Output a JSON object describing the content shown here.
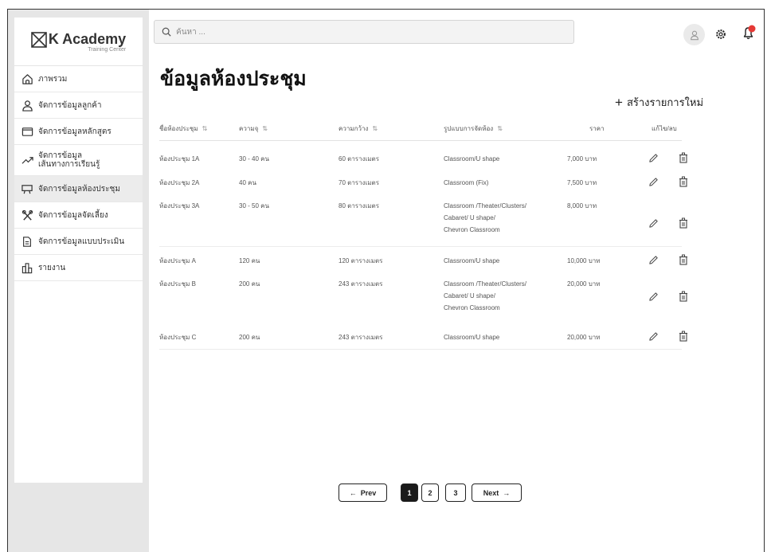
{
  "brand": {
    "title": "K Academy",
    "subtitle": "Training Center"
  },
  "sidebar": {
    "items": [
      {
        "label": "ภาพรวม"
      },
      {
        "label": "จัดการข้อมูลลูกค้า"
      },
      {
        "label": "จัดการข้อมูลหลักสูตร"
      },
      {
        "label_line1": "จัดการข้อมูล",
        "label_line2": "เส้นทางการเรียนรู้"
      },
      {
        "label": "จัดการข้อมูลห้องประชุม",
        "active": true
      },
      {
        "label": "จัดการข้อมูลจัดเลี้ยง"
      },
      {
        "label": "จัดการข้อมูลแบบประเมิน"
      },
      {
        "label": "รายงาน"
      }
    ]
  },
  "search": {
    "placeholder": "ค้นหา ..."
  },
  "notifications": {
    "badge_color": "#e53935"
  },
  "page": {
    "title": "ข้อมูลห้องประชุม",
    "create_label": "สร้างรายการใหม่"
  },
  "table": {
    "headers": {
      "name": "ชื่อห้องประชุม",
      "capacity": "ความจุ",
      "width": "ความกว้าง",
      "layout": "รูปแบบการจัดห้อง",
      "price": "ราคา",
      "actions": "แก้ไข/ลบ"
    },
    "rows": [
      {
        "name": "ห้องประชุม 1A",
        "capacity": "30 - 40 คน",
        "width": "60 ตารางเมตร",
        "layout": [
          "Classroom/U shape"
        ],
        "price": "7,000 บาท"
      },
      {
        "name": "ห้องประชุม 2A",
        "capacity": "40 คน",
        "width": "70 ตารางเมตร",
        "layout": [
          "Classroom (Fix)"
        ],
        "price": "7,500 บาท"
      },
      {
        "name": "ห้องประชุม 3A",
        "capacity": "30 - 50 คน",
        "width": "80 ตารางเมตร",
        "layout": [
          "Classroom /Theater/Clusters/",
          "Cabaret/ U shape/",
          "Chevron Classroom"
        ],
        "price": "8,000 บาท"
      },
      {
        "name": "ห้องประชุม A",
        "capacity": "120 คน",
        "width": "120 ตารางเมตร",
        "layout": [
          "Classroom/U shape"
        ],
        "price": "10,000 บาท"
      },
      {
        "name": "ห้องประชุม B",
        "capacity": "200 คน",
        "width": "243 ตารางเมตร",
        "layout": [
          "Classroom /Theater/Clusters/",
          "Cabaret/ U shape/",
          "Chevron Classroom"
        ],
        "price": "20,000 บาท"
      },
      {
        "name": "ห้องประชุม C",
        "capacity": "200 คน",
        "width": "243 ตารางเมตร",
        "layout": [
          "Classroom/U shape"
        ],
        "price": "20,000 บาท"
      }
    ]
  },
  "pagination": {
    "prev": "Prev",
    "next": "Next",
    "pages": [
      "1",
      "2",
      "3"
    ],
    "current": "1"
  }
}
